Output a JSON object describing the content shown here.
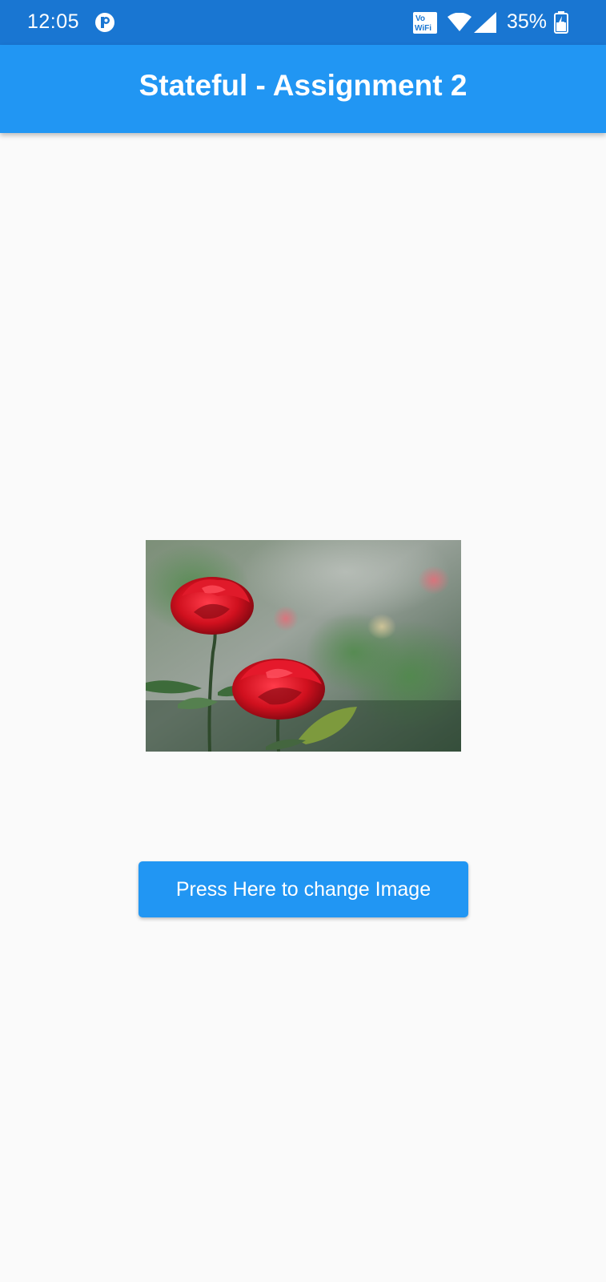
{
  "status_bar": {
    "time": "12:05",
    "battery_percent": "35%",
    "app_icon": "p-circle-icon",
    "network_icons": [
      "vowifi-icon",
      "wifi-icon",
      "signal-icon",
      "battery-charging-icon"
    ]
  },
  "app_bar": {
    "title": "Stateful - Assignment 2",
    "color": "#2196f3"
  },
  "image": {
    "subject": "two red roses",
    "alt": "Red roses"
  },
  "button": {
    "label": "Press Here to change Image",
    "color": "#2196f3"
  }
}
